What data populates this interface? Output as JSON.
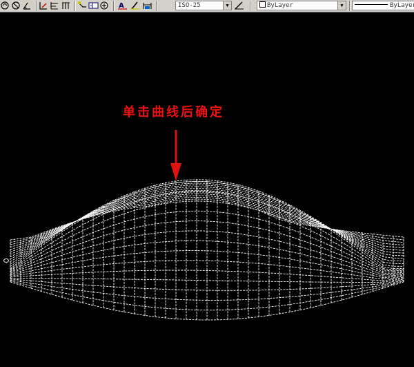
{
  "toolbar": {
    "dimstyle_value": "ISO-25",
    "layer_color_value": "ByLayer",
    "linetype_value": "ByLayer",
    "colors": {
      "face": "#d4d0c8",
      "shadow": "#808080"
    }
  },
  "annotation": {
    "text": "单击曲线后确定",
    "color": "#e11111"
  },
  "viewport": {
    "background": "#000000",
    "mesh_color": "#ffffff"
  }
}
